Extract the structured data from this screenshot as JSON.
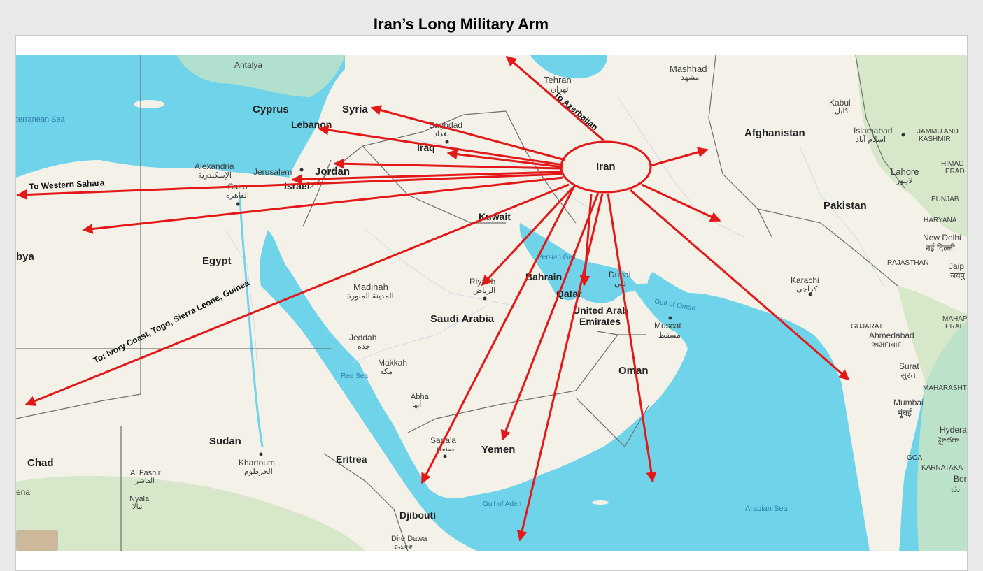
{
  "title": "Iran’s Long Military Arm",
  "colors": {
    "sea": "#6fd3ea",
    "land": "#f4f1e9",
    "green": "#cfe6c2",
    "arrow": "#e31818",
    "border": "#6f6f6f"
  },
  "origin_label": "Iran",
  "annotations": {
    "azerbaijan": "To Azerbaijan",
    "western_sahara": "To Western Sahara",
    "west_africa": "To: Ivory Coast, Togo, Sierra Leone, Guinea"
  },
  "map_labels": {
    "antalya": "Antalya",
    "tehran": "Tehran",
    "tehran_local": "تهران",
    "mashhad": "Mashhad",
    "mashhad_local": "مشهد",
    "cyprus": "Cyprus",
    "syria": "Syria",
    "lebanon": "Lebanon",
    "baghdad": "Baghdad",
    "baghdad_local": "بغداد",
    "iraq": "Iraq",
    "kabul": "Kabul",
    "kabul_local": "کابل",
    "afghanistan": "Afghanistan",
    "islamabad": "Islamabad",
    "islamabad_local": "اسلام آباد",
    "jammu": "JAMMU AND",
    "kashmir": "KASHMIR",
    "himac": "HIMAC",
    "prad": "PRAD",
    "lahore": "Lahore",
    "lahore_local": "لاہور",
    "punjab": "PUNJAB",
    "alexandria": "Alexandria",
    "alexandria_local": "الإسكندرية",
    "jerusalem": "Jerusalem",
    "jordan": "Jordan",
    "israel": "Israel",
    "cairo": "Cairo",
    "cairo_local": "القاهرة",
    "mediterranean": "terranean Sea",
    "pakistan": "Pakistan",
    "haryana": "HARYANA",
    "new_delhi": "New Delhi",
    "new_delhi_local": "नई दिल्ली",
    "kuwait": "Kuwait",
    "libya": "bya",
    "egypt": "Egypt",
    "persian_gulf": "Persian Gulf",
    "dubai": "Dubai",
    "dubai_local": "دبي",
    "rajasthan": "RAJASTHAN",
    "jaip": "Jaip",
    "jaip_local": "जयपु",
    "madinah": "Madinah",
    "madinah_local": "المدينة المنورة",
    "riyadh": "Riyadh",
    "riyadh_local": "الرياض",
    "bahrain": "Bahrain",
    "qatar": "Qatar",
    "karachi": "Karachi",
    "karachi_local": "کراچی",
    "gulf_oman": "Gulf of Oman",
    "uae1": "United Arab",
    "uae2": "Emirates",
    "muscat": "Muscat",
    "muscat_local": "مسقط",
    "saudi": "Saudi Arabia",
    "gujarat": "GUJARAT",
    "ahmedabad": "Ahmedabad",
    "ahmedabad_local": "અમદાવાદ",
    "jeddah": "Jeddah",
    "jeddah_local": "جدة",
    "mahap": "MAHAP",
    "prai": "PRAI",
    "makkah": "Makkah",
    "makkah_local": "مكة",
    "oman": "Oman",
    "red_sea": "Red Sea",
    "surat": "Surat",
    "surat_local": "સુરત",
    "abha": "Abha",
    "abha_local": "أبها",
    "maharashtra": "MAHARASHTI",
    "mumbai": "Mumbai",
    "mumbai_local": "मुंबई",
    "sanaa": "Sana'a",
    "sanaa_local": "صنعاء",
    "hyder": "Hydera",
    "hyder_local": "హైదరా",
    "sudan": "Sudan",
    "yemen": "Yemen",
    "khartoum": "Khartoum",
    "khartoum_local": "الخرطوم",
    "eritrea": "Eritrea",
    "chad": "Chad",
    "goa": "GOA",
    "karnataka": "KARNATAKA",
    "al_fashir": "Al Fashir",
    "al_fashir_local": "الفاشر",
    "ber": "Ber",
    "ber_local": "ಬೆಂ",
    "nyala": "Nyala",
    "nyala_local": "نيالا",
    "gulf_aden": "Gulf of Aden",
    "arabian_sea": "Arabian Sea",
    "ena": "ena",
    "djibouti": "Djibouti",
    "dire_dawa": "Dire Dawa",
    "dire_dawa_local": "ድሬዳዋ"
  }
}
